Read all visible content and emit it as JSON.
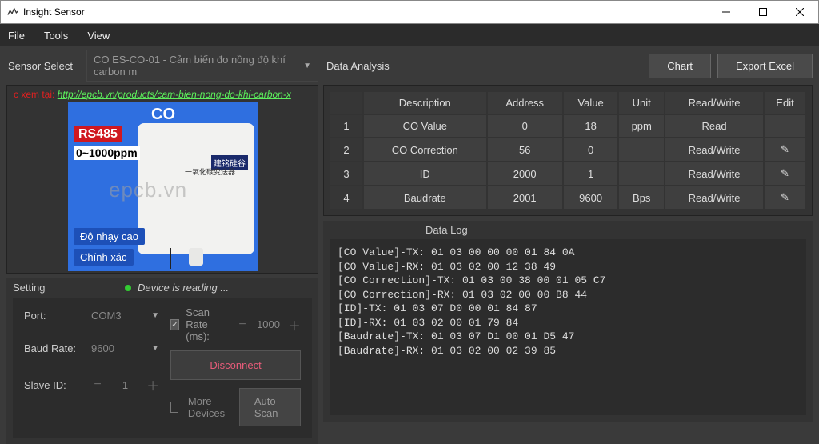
{
  "window": {
    "title": "Insight Sensor"
  },
  "menu": {
    "file": "File",
    "tools": "Tools",
    "view": "View"
  },
  "sensor_select": {
    "label": "Sensor Select",
    "value": "CO ES-CO-01 - Cảm biến đo nồng độ khí carbon m",
    "link_prefix": "c xem tại:",
    "link_text": "http://epcb.vn/products/cam-bien-nong-do-khi-carbon-x"
  },
  "sensor_image": {
    "co": "CO",
    "rs485": "RS485",
    "ppm": "0~1000ppm",
    "watermark": "epcb.vn",
    "badge1": "Độ nhạy cao",
    "badge2": "Chính xác",
    "chinese1": "建铭硅谷",
    "chinese2": "一氧化碳变送器"
  },
  "setting": {
    "title": "Setting",
    "status": "Device is reading ...",
    "port_label": "Port:",
    "port_value": "COM3",
    "baud_label": "Baud Rate:",
    "baud_value": "9600",
    "slave_label": "Slave ID:",
    "slave_value": "1",
    "scan_label": "Scan Rate (ms):",
    "scan_value": "1000",
    "disconnect": "Disconnect",
    "more_devices": "More Devices",
    "auto_scan": "Auto Scan"
  },
  "data_analysis": {
    "label": "Data Analysis",
    "chart_btn": "Chart",
    "export_btn": "Export Excel",
    "headers": {
      "num": "",
      "desc": "Description",
      "addr": "Address",
      "value": "Value",
      "unit": "Unit",
      "rw": "Read/Write",
      "edit": "Edit"
    },
    "rows": [
      {
        "n": "1",
        "desc": "CO Value",
        "addr": "0",
        "value": "18",
        "unit": "ppm",
        "rw": "Read",
        "edit": ""
      },
      {
        "n": "2",
        "desc": "CO Correction",
        "addr": "56",
        "value": "0",
        "unit": "",
        "rw": "Read/Write",
        "edit": "✎"
      },
      {
        "n": "3",
        "desc": "ID",
        "addr": "2000",
        "value": "1",
        "unit": "",
        "rw": "Read/Write",
        "edit": "✎"
      },
      {
        "n": "4",
        "desc": "Baudrate",
        "addr": "2001",
        "value": "9600",
        "unit": "Bps",
        "rw": "Read/Write",
        "edit": "✎"
      }
    ]
  },
  "data_log": {
    "title": "Data Log",
    "lines": "[CO Value]-TX: 01 03 00 00 00 01 84 0A\n[CO Value]-RX: 01 03 02 00 12 38 49\n[CO Correction]-TX: 01 03 00 38 00 01 05 C7\n[CO Correction]-RX: 01 03 02 00 00 B8 44\n[ID]-TX: 01 03 07 D0 00 01 84 87\n[ID]-RX: 01 03 02 00 01 79 84\n[Baudrate]-TX: 01 03 07 D1 00 01 D5 47\n[Baudrate]-RX: 01 03 02 00 02 39 85"
  }
}
